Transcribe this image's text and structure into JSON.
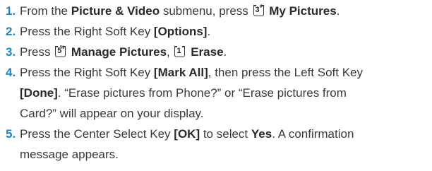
{
  "steps": [
    {
      "number": "1.",
      "t1": "From the ",
      "b1": "Picture & Video",
      "t2": " submenu, press ",
      "key": {
        "digit": "3",
        "symbol": "#"
      },
      "b2": "My Pictures",
      "t3": "."
    },
    {
      "number": "2.",
      "t1": "Press the Right Soft Key ",
      "b1": "[Options]",
      "t2": "."
    },
    {
      "number": "3.",
      "t1": "Press ",
      "key1": {
        "digit": "5",
        "symbol": "%"
      },
      "b1": "Manage Pictures",
      "t2": ", ",
      "key2": {
        "digit": "1",
        "symbol": ""
      },
      "b2": "Erase",
      "t3": "."
    },
    {
      "number": "4.",
      "t1": "Press the Right Soft Key ",
      "b1": "[Mark All]",
      "t2": ", then press the Left Soft Key",
      "b2": "[Done]",
      "t3": ". “Erase pictures from Phone?” or “Erase pictures from",
      "t4": "Card?” will appear on your display."
    },
    {
      "number": "5.",
      "t1": "Press the Center Select Key ",
      "b1": "[OK]",
      "t2": " to select ",
      "b2": "Yes",
      "t3": ". A confirmation",
      "t4": "message appears."
    }
  ],
  "colors": {
    "number": "#1a86c8",
    "text": "#3a3a3a"
  },
  "icons": [
    "key-3-icon",
    "key-5-icon",
    "key-1-icon"
  ]
}
